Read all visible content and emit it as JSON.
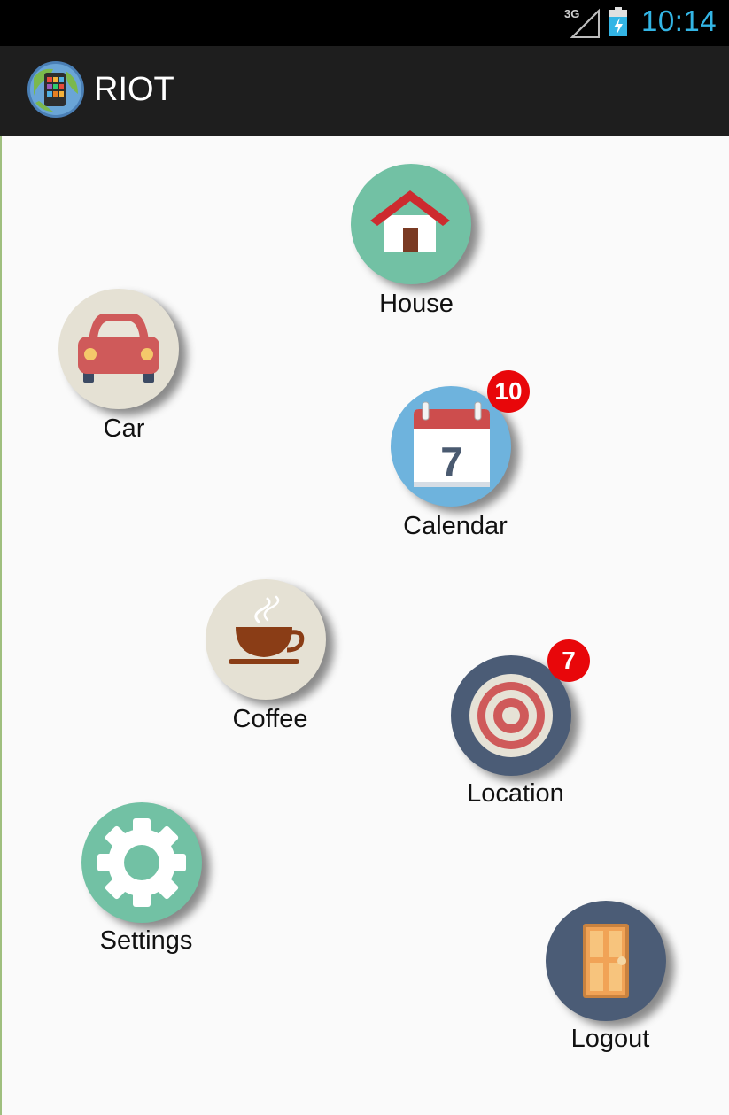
{
  "status_bar": {
    "network": "3G",
    "time": "10:14"
  },
  "app_bar": {
    "title": "RIOT",
    "logo_icon": "globe-phone-icon"
  },
  "tiles": {
    "house": {
      "label": "House",
      "icon": "house-icon",
      "color": "#72c1a4"
    },
    "car": {
      "label": "Car",
      "icon": "car-icon",
      "color": "#e5e1d4"
    },
    "calendar": {
      "label": "Calendar",
      "icon": "calendar-icon",
      "color": "#6eb3dd",
      "badge": "10"
    },
    "coffee": {
      "label": "Coffee",
      "icon": "coffee-cup-icon",
      "color": "#e5e1d4"
    },
    "location": {
      "label": "Location",
      "icon": "target-icon",
      "color": "#4b5c76",
      "badge": "7"
    },
    "settings": {
      "label": "Settings",
      "icon": "gear-icon",
      "color": "#72c1a4"
    },
    "logout": {
      "label": "Logout",
      "icon": "door-icon",
      "color": "#4b5c76"
    }
  }
}
